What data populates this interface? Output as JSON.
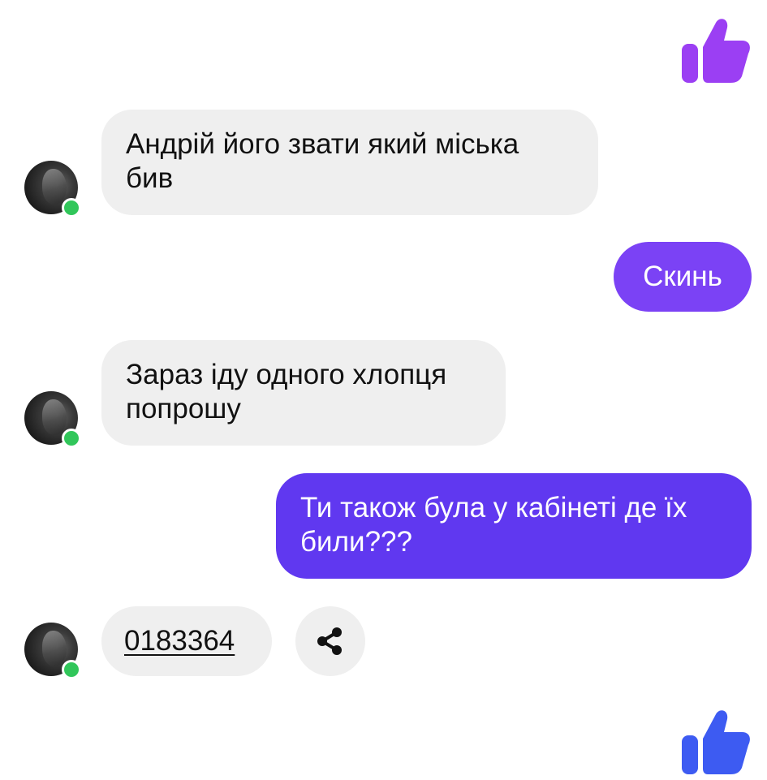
{
  "theme": {
    "like_top_color": "#9b3ff3",
    "like_bottom_color": "#3d5bf2",
    "outgoing_bubble_color_1": "#7b42f5",
    "outgoing_bubble_color_2": "#6038f0",
    "incoming_bubble_color": "#efefef",
    "online_dot_color": "#31c65a"
  },
  "messages": [
    {
      "direction": "outgoing",
      "type": "like",
      "icon": "thumbs-up-icon"
    },
    {
      "direction": "incoming",
      "text": "Андрій його звати який міська бив"
    },
    {
      "direction": "outgoing",
      "text": "Скинь"
    },
    {
      "direction": "incoming",
      "text": "Зараз іду одного хлопця попрошу"
    },
    {
      "direction": "outgoing",
      "text": "Ти також була у кабінеті де їх били???"
    },
    {
      "direction": "incoming",
      "text": "0183364",
      "type": "phone-link",
      "action_icon": "share-icon"
    },
    {
      "direction": "outgoing",
      "type": "like",
      "icon": "thumbs-up-icon"
    }
  ]
}
